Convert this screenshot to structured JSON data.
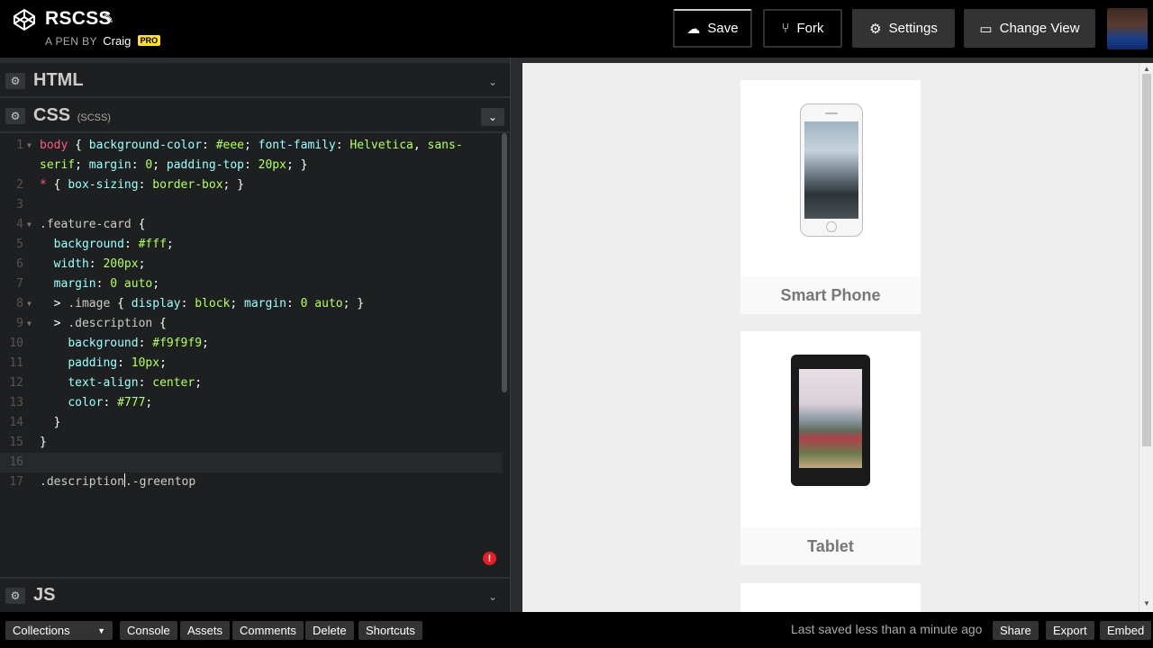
{
  "header": {
    "title": "RSCSS",
    "byline_label": "A PEN BY",
    "author": "Craig",
    "badge": "PRO",
    "buttons": {
      "save": "Save",
      "fork": "Fork",
      "settings": "Settings",
      "change_view": "Change View"
    }
  },
  "panels": {
    "html": {
      "title": "HTML"
    },
    "css": {
      "title": "CSS",
      "subtitle": "(SCSS)"
    },
    "js": {
      "title": "JS"
    }
  },
  "code": {
    "line_numbers": [
      "1",
      "",
      "2",
      "3",
      "4",
      "5",
      "6",
      "7",
      "8",
      "9",
      "10",
      "11",
      "12",
      "13",
      "14",
      "15",
      "16",
      "17"
    ],
    "l1a_sel": "body",
    "l1a_p1": "background-color",
    "l1a_v1": "#eee",
    "l1a_p2": "font-family",
    "l1a_v2": "Helvetica",
    "l1a_v3": "sans-",
    "l1b_v3": "serif",
    "l1b_p3": "margin",
    "l1b_v4": "0",
    "l1b_p4": "padding-top",
    "l1b_v5": "20px",
    "l2_p": "box-sizing",
    "l2_v": "border-box",
    "l4_sel": ".feature-card",
    "l5_p": "background",
    "l5_v": "#fff",
    "l6_p": "width",
    "l6_v": "200px",
    "l7_p": "margin",
    "l7_v": "0 auto",
    "l8_sel": ".image",
    "l8_p1": "display",
    "l8_v1": "block",
    "l8_p2": "margin",
    "l8_v2": "0 auto",
    "l9_sel": ".description",
    "l10_p": "background",
    "l10_v": "#f9f9f9",
    "l11_p": "padding",
    "l11_v": "10px",
    "l12_p": "text-align",
    "l12_v": "center",
    "l13_p": "color",
    "l13_v": "#777",
    "l17_a": ".description",
    "l17_b": ".-greentop"
  },
  "preview": {
    "cards": [
      {
        "label": "Smart Phone"
      },
      {
        "label": "Tablet"
      }
    ]
  },
  "footer": {
    "collections": "Collections",
    "console": "Console",
    "assets": "Assets",
    "comments": "Comments",
    "delete": "Delete",
    "shortcuts": "Shortcuts",
    "saved_status": "Last saved less than a minute ago",
    "share": "Share",
    "export": "Export",
    "embed": "Embed"
  },
  "colors": {
    "accent_pro": "#ffdd40",
    "error": "#e0202a",
    "code_property": "#9effff",
    "code_value": "#b4ff63",
    "code_selector": "#fb5b7e"
  }
}
